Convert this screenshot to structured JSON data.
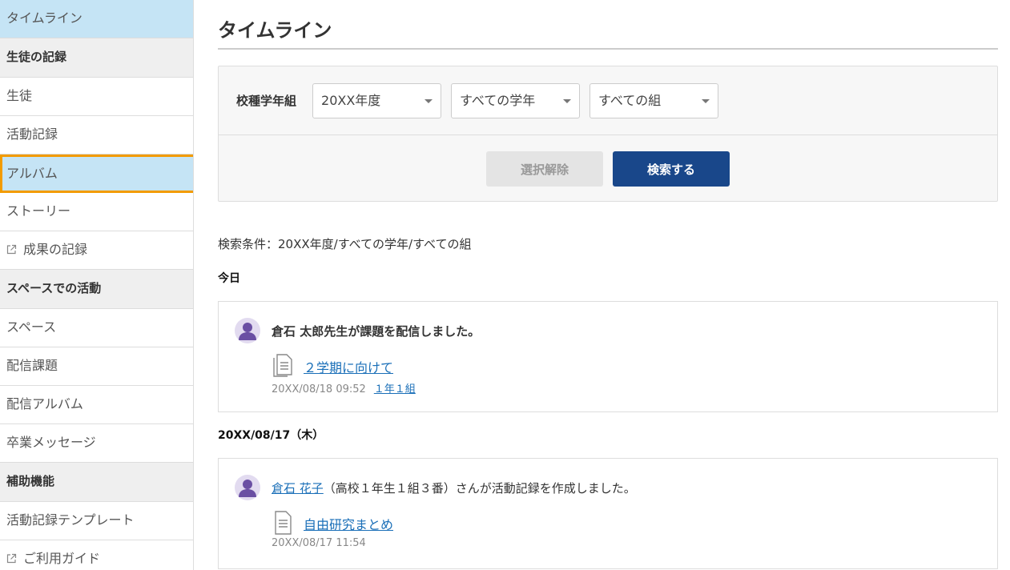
{
  "sidebar": {
    "items": [
      {
        "label": "タイムライン",
        "type": "item",
        "state": "active"
      },
      {
        "label": "生徒の記録",
        "type": "header"
      },
      {
        "label": "生徒",
        "type": "item"
      },
      {
        "label": "活動記録",
        "type": "item"
      },
      {
        "label": "アルバム",
        "type": "item",
        "state": "highlight"
      },
      {
        "label": "ストーリー",
        "type": "item"
      },
      {
        "label": "成果の記録",
        "type": "item",
        "icon": "external-link-icon"
      },
      {
        "label": "スペースでの活動",
        "type": "header"
      },
      {
        "label": "スペース",
        "type": "item"
      },
      {
        "label": "配信課題",
        "type": "item"
      },
      {
        "label": "配信アルバム",
        "type": "item"
      },
      {
        "label": "卒業メッセージ",
        "type": "item"
      },
      {
        "label": "補助機能",
        "type": "header"
      },
      {
        "label": "活動記録テンプレート",
        "type": "item"
      },
      {
        "label": "ご利用ガイド",
        "type": "item",
        "icon": "external-link-icon"
      }
    ]
  },
  "main": {
    "title": "タイムライン",
    "search": {
      "label": "校種学年組",
      "year_select": "20XX年度",
      "grade_select": "すべての学年",
      "class_select": "すべての組",
      "clear_label": "選択解除",
      "search_label": "検索する"
    },
    "conditions": "検索条件：20XX年度/すべての学年/すべての組",
    "groups": [
      {
        "date": "今日",
        "entry": {
          "text": "倉石 太郎先生が課題を配信しました。",
          "doc_title": "２学期に向けて",
          "timestamp": "20XX/08/18 09:52",
          "class_link": "１年１組"
        }
      },
      {
        "date": "20XX/08/17（木）",
        "entry": {
          "user_link": "倉石 花子",
          "text": "（高校１年生１組３番）さんが活動記録を作成しました。",
          "doc_title": "自由研究まとめ",
          "timestamp": "20XX/08/17 11:54"
        }
      }
    ]
  },
  "colors": {
    "active_bg": "#c5e4f5",
    "highlight_border": "#f29b00",
    "primary_button": "#19478a",
    "link": "#1a6fb8",
    "avatar": "#6a4fa3"
  }
}
